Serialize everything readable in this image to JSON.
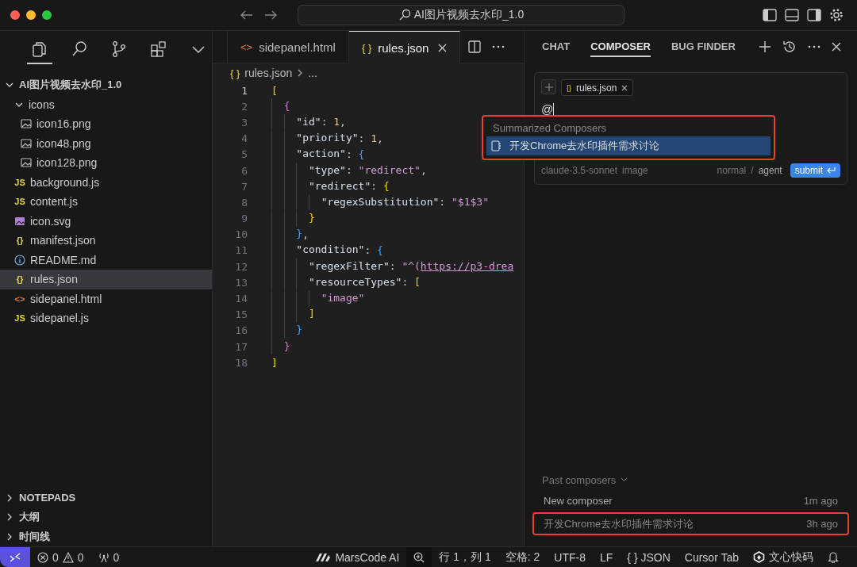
{
  "window": {
    "title": "AI图片视频去水印_1.0"
  },
  "activity_bar": [
    {
      "kind": "files",
      "selected": true
    },
    {
      "kind": "search",
      "selected": false
    },
    {
      "kind": "source-control",
      "selected": false
    },
    {
      "kind": "extensions",
      "selected": false
    },
    {
      "kind": "more",
      "selected": false
    }
  ],
  "explorer": {
    "root": "AI图片视频去水印_1.0",
    "expanded": true,
    "items": [
      {
        "name": "icons",
        "kind": "folder",
        "expanded": true,
        "selected": false,
        "children": [
          {
            "name": "icon16.png",
            "kind": "image",
            "selected": false
          },
          {
            "name": "icon48.png",
            "kind": "image",
            "selected": false
          },
          {
            "name": "icon128.png",
            "kind": "image",
            "selected": false
          }
        ]
      },
      {
        "name": "background.js",
        "kind": "js",
        "glyph": "JS",
        "selected": false
      },
      {
        "name": "content.js",
        "kind": "js",
        "glyph": "JS",
        "selected": false
      },
      {
        "name": "icon.svg",
        "kind": "svg",
        "selected": false
      },
      {
        "name": "manifest.json",
        "kind": "json",
        "glyph": "{}",
        "selected": false
      },
      {
        "name": "README.md",
        "kind": "info",
        "selected": false
      },
      {
        "name": "rules.json",
        "kind": "json",
        "glyph": "{}",
        "selected": true
      },
      {
        "name": "sidepanel.html",
        "kind": "html",
        "glyph": "<>",
        "selected": false
      },
      {
        "name": "sidepanel.js",
        "kind": "js",
        "glyph": "JS",
        "selected": false
      }
    ]
  },
  "sections": [
    {
      "label": "NOTEPADS",
      "expanded": false
    },
    {
      "label": "大纲",
      "expanded": false
    },
    {
      "label": "时间线",
      "expanded": false
    }
  ],
  "editor": {
    "tabs": [
      {
        "label": "sidepanel.html",
        "kind": "html",
        "glyph": "<>",
        "selected": false
      },
      {
        "label": "rules.json",
        "kind": "json",
        "glyph": "{ }",
        "selected": true
      }
    ],
    "breadcrumb": {
      "glyph": "{ }",
      "file": "rules.json",
      "more": "..."
    },
    "lines": [
      {
        "number": "1",
        "tokens": [
          {
            "text": "[",
            "kind": "bracket1"
          }
        ]
      },
      {
        "number": "2",
        "tokens": [
          {
            "text": "  {",
            "kind": "bracket2"
          }
        ]
      },
      {
        "number": "3",
        "tokens": [
          {
            "text": "    \"id\"",
            "kind": "key"
          },
          {
            "text": ": ",
            "kind": "punct"
          },
          {
            "text": "1",
            "kind": "number"
          },
          {
            "text": ",",
            "kind": "punct"
          }
        ]
      },
      {
        "number": "4",
        "tokens": [
          {
            "text": "    \"priority\"",
            "kind": "key"
          },
          {
            "text": ": ",
            "kind": "punct"
          },
          {
            "text": "1",
            "kind": "number"
          },
          {
            "text": ",",
            "kind": "punct"
          }
        ]
      },
      {
        "number": "5",
        "tokens": [
          {
            "text": "    \"action\"",
            "kind": "key"
          },
          {
            "text": ": ",
            "kind": "punct"
          },
          {
            "text": "{",
            "kind": "bracket3"
          }
        ]
      },
      {
        "number": "6",
        "tokens": [
          {
            "text": "      \"type\"",
            "kind": "key"
          },
          {
            "text": ": ",
            "kind": "punct"
          },
          {
            "text": "\"redirect\"",
            "kind": "string"
          },
          {
            "text": ",",
            "kind": "punct"
          }
        ]
      },
      {
        "number": "7",
        "tokens": [
          {
            "text": "      \"redirect\"",
            "kind": "key"
          },
          {
            "text": ": ",
            "kind": "punct"
          },
          {
            "text": "{",
            "kind": "bracket1"
          }
        ]
      },
      {
        "number": "8",
        "tokens": [
          {
            "text": "        \"regexSubstitution\"",
            "kind": "key"
          },
          {
            "text": ": ",
            "kind": "punct"
          },
          {
            "text": "\"$1$3\"",
            "kind": "string"
          }
        ]
      },
      {
        "number": "9",
        "tokens": [
          {
            "text": "      }",
            "kind": "bracket1"
          }
        ]
      },
      {
        "number": "10",
        "tokens": [
          {
            "text": "    }",
            "kind": "bracket3"
          },
          {
            "text": ",",
            "kind": "punct"
          }
        ]
      },
      {
        "number": "11",
        "tokens": [
          {
            "text": "    \"condition\"",
            "kind": "key"
          },
          {
            "text": ": ",
            "kind": "punct"
          },
          {
            "text": "{",
            "kind": "bracket3"
          }
        ]
      },
      {
        "number": "12",
        "tokens": [
          {
            "text": "      \"regexFilter\"",
            "kind": "key"
          },
          {
            "text": ": ",
            "kind": "punct"
          },
          {
            "text": "\"^(",
            "kind": "string"
          },
          {
            "text": "https://p3-drea",
            "kind": "link"
          }
        ]
      },
      {
        "number": "13",
        "tokens": [
          {
            "text": "      \"resourceTypes\"",
            "kind": "key"
          },
          {
            "text": ": ",
            "kind": "punct"
          },
          {
            "text": "[",
            "kind": "bracket1"
          }
        ]
      },
      {
        "number": "14",
        "tokens": [
          {
            "text": "        \"image\"",
            "kind": "string"
          }
        ]
      },
      {
        "number": "15",
        "tokens": [
          {
            "text": "      ]",
            "kind": "bracket1"
          }
        ]
      },
      {
        "number": "16",
        "tokens": [
          {
            "text": "    }",
            "kind": "bracket3"
          }
        ]
      },
      {
        "number": "17",
        "tokens": [
          {
            "text": "  }",
            "kind": "bracket2"
          }
        ]
      },
      {
        "number": "18",
        "tokens": [
          {
            "text": "]",
            "kind": "bracket1"
          }
        ]
      }
    ]
  },
  "panel": {
    "tabs": [
      {
        "label": "CHAT",
        "selected": false
      },
      {
        "label": "COMPOSER",
        "selected": true
      },
      {
        "label": "BUG FINDER",
        "selected": false
      }
    ],
    "composer": {
      "chips": [
        {
          "glyph": "{}",
          "label": "rules.json"
        }
      ],
      "input": "@",
      "model": "claude-3.5-sonnet",
      "attach": "image",
      "mode": "normal",
      "mode_sep": "/",
      "agent": "agent",
      "submit": "submit"
    },
    "mention_popup": {
      "header": "Summarized Composers",
      "annotated": true,
      "items": [
        {
          "label": "开发Chrome去水印插件需求讨论",
          "selected": true
        }
      ]
    },
    "past_composers": {
      "label": "Past composers",
      "items": [
        {
          "title": "New composer",
          "time": "1m ago",
          "annotated": false
        },
        {
          "title": "开发Chrome去水印插件需求讨论",
          "time": "3h ago",
          "annotated": true
        }
      ]
    }
  },
  "status_bar": {
    "errors": "0",
    "warnings": "0",
    "ports": "0",
    "right": [
      {
        "kind": "marscode",
        "label": "MarsCode AI"
      },
      {
        "kind": "zoom"
      },
      {
        "kind": "text",
        "label": "行 1，列 1"
      },
      {
        "kind": "text",
        "label": "空格: 2"
      },
      {
        "kind": "text",
        "label": "UTF-8"
      },
      {
        "kind": "text",
        "label": "LF"
      },
      {
        "kind": "lang",
        "glyph": "{ }",
        "label": "JSON"
      },
      {
        "kind": "text",
        "label": "Cursor Tab"
      },
      {
        "kind": "wenxin",
        "label": "文心快码"
      },
      {
        "kind": "bell"
      }
    ]
  }
}
